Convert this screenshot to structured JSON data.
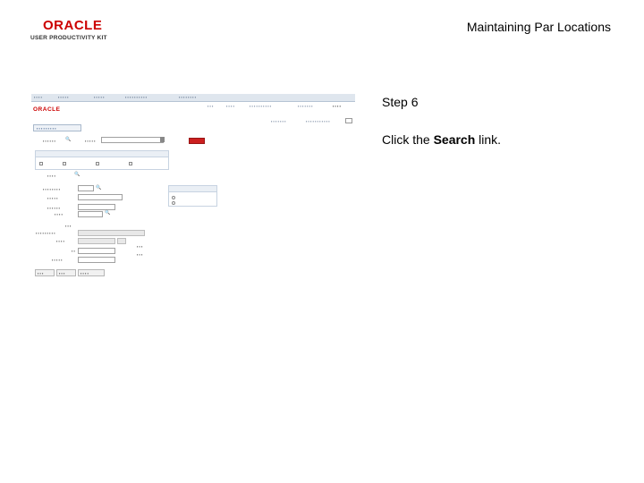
{
  "logo": {
    "brand": "ORACLE",
    "subtitle": "USER PRODUCTIVITY KIT"
  },
  "doc_title": "Maintaining Par Locations",
  "step": {
    "label": "Step 6",
    "instruction_prefix": "Click the ",
    "instruction_target": "Search",
    "instruction_suffix": " link."
  },
  "colors": {
    "oracle_red": "#cc0000",
    "nav_bg": "#dfe6ee",
    "button_red": "#cc1f1f"
  }
}
